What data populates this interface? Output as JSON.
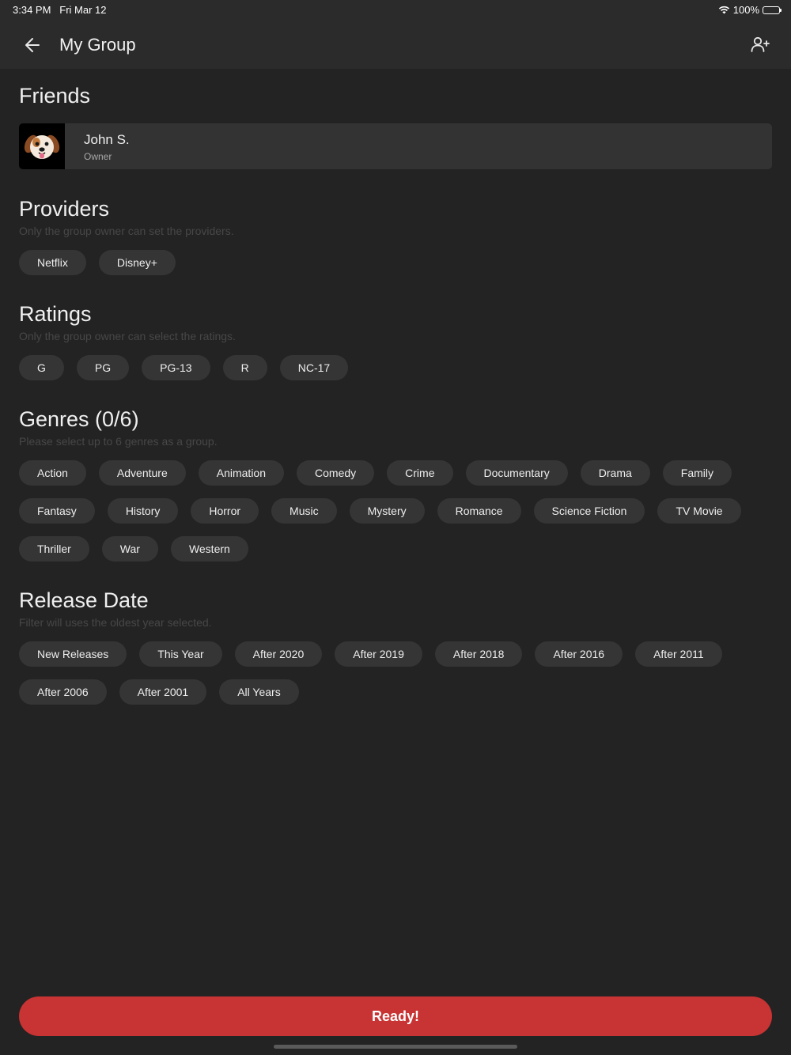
{
  "status_bar": {
    "time": "3:34 PM",
    "date": "Fri Mar 12",
    "battery": "100%",
    "wifi_icon": "wifi-icon"
  },
  "header": {
    "title": "My Group",
    "back_icon": "arrow-left-icon",
    "add_user_icon": "person-add-icon"
  },
  "friends": {
    "title": "Friends",
    "members": [
      {
        "name": "John S.",
        "role": "Owner",
        "avatar": "dog-emoji-avatar"
      }
    ]
  },
  "providers": {
    "title": "Providers",
    "subtitle": "Only the group owner can set the providers.",
    "items": [
      "Netflix",
      "Disney+"
    ]
  },
  "ratings": {
    "title": "Ratings",
    "subtitle": "Only the group owner can select the ratings.",
    "items": [
      "G",
      "PG",
      "PG-13",
      "R",
      "NC-17"
    ]
  },
  "genres": {
    "title": "Genres (0/6)",
    "subtitle": "Please select up to 6 genres as a group.",
    "items": [
      "Action",
      "Adventure",
      "Animation",
      "Comedy",
      "Crime",
      "Documentary",
      "Drama",
      "Family",
      "Fantasy",
      "History",
      "Horror",
      "Music",
      "Mystery",
      "Romance",
      "Science Fiction",
      "TV Movie",
      "Thriller",
      "War",
      "Western"
    ]
  },
  "release_date": {
    "title": "Release Date",
    "subtitle": "Filter will uses the oldest year selected.",
    "items": [
      "New Releases",
      "This Year",
      "After 2020",
      "After 2019",
      "After 2018",
      "After 2016",
      "After 2011",
      "After 2006",
      "After 2001",
      "All Years"
    ]
  },
  "ready_button": "Ready!",
  "colors": {
    "background": "#232323",
    "chip": "#353535",
    "accent": "#c83333",
    "header": "#2b2b2b"
  }
}
